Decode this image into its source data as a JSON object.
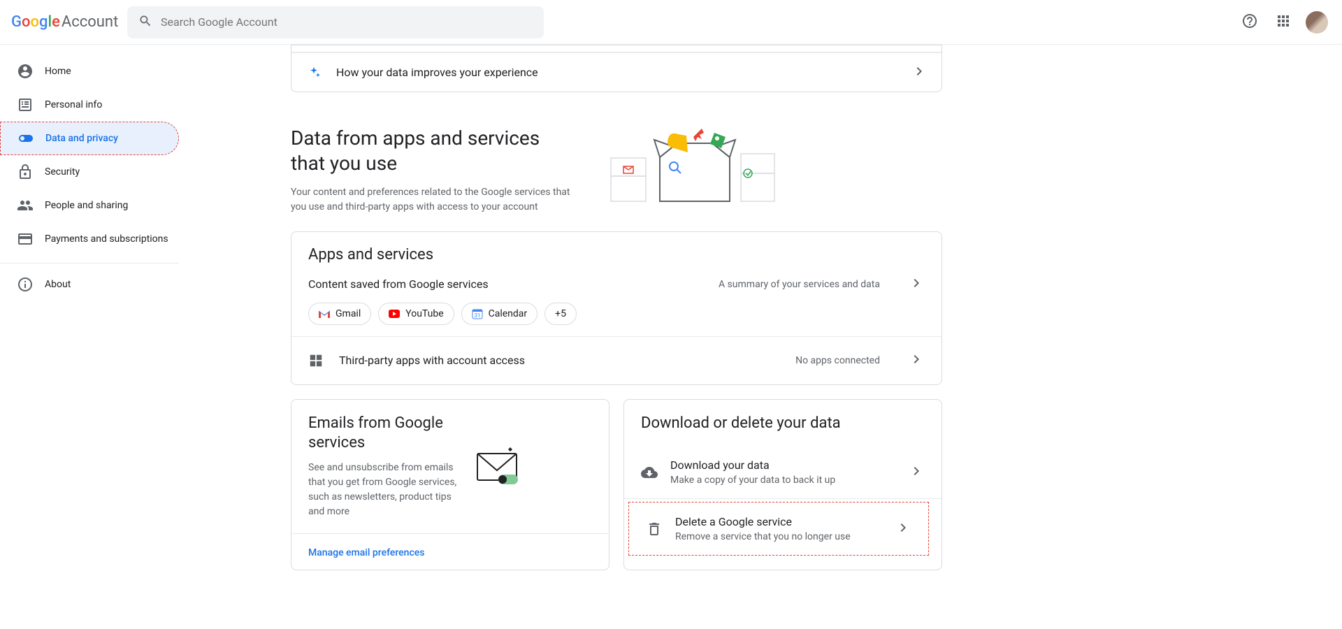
{
  "header": {
    "logo_account": "Account",
    "search_placeholder": "Search Google Account"
  },
  "sidebar": {
    "items": [
      {
        "label": "Home"
      },
      {
        "label": "Personal info"
      },
      {
        "label": "Data and privacy"
      },
      {
        "label": "Security"
      },
      {
        "label": "People and sharing"
      },
      {
        "label": "Payments and subscriptions"
      }
    ],
    "about": "About"
  },
  "top_row": {
    "experience": "How your data improves your experience"
  },
  "section": {
    "title": "Data from apps and services that you use",
    "desc": "Your content and preferences related to the Google services that you use and third-party apps with access to your account"
  },
  "apps_card": {
    "title": "Apps and services",
    "content_saved": "Content saved from Google services",
    "summary": "A summary of your services and data",
    "chips": {
      "gmail": "Gmail",
      "youtube": "YouTube",
      "calendar": "Calendar",
      "more": "+5"
    },
    "third_party": "Third-party apps with account access",
    "no_apps": "No apps connected"
  },
  "emails_card": {
    "title": "Emails from Google services",
    "desc": "See and unsubscribe from emails that you get from Google services, such as newsletters, product tips and more",
    "link": "Manage email preferences"
  },
  "download_card": {
    "title": "Download or delete your data",
    "download": {
      "t1": "Download your data",
      "t2": "Make a copy of your data to back it up"
    },
    "delete": {
      "t1": "Delete a Google service",
      "t2": "Remove a service that you no longer use"
    }
  }
}
